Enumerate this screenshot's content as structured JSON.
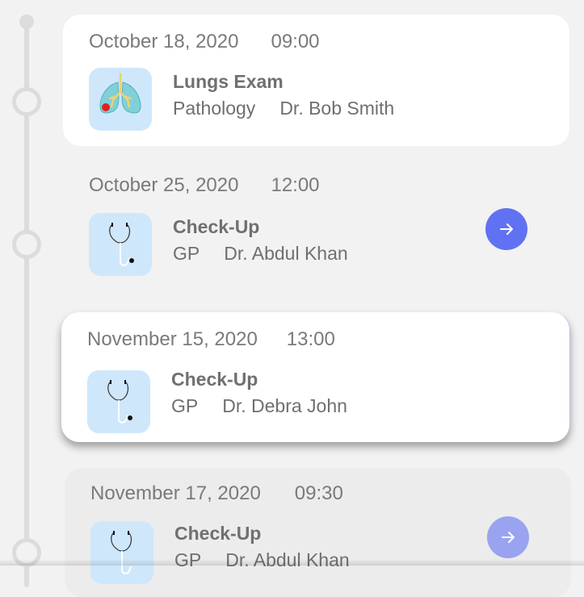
{
  "appointments": [
    {
      "date": "October 18, 2020",
      "time": "09:00",
      "title": "Lungs Exam",
      "department": "Pathology",
      "doctor": "Dr. Bob Smith",
      "icon": "lungs-icon"
    },
    {
      "date": "October 25, 2020",
      "time": "12:00",
      "title": "Check-Up",
      "department": "GP",
      "doctor": "Dr. Abdul Khan",
      "icon": "stethoscope-icon",
      "action_icon": "arrow-right-icon"
    },
    {
      "date": "November 15, 2020",
      "time": "13:00",
      "title": "Check-Up",
      "department": "GP",
      "doctor": "Dr. Debra John",
      "icon": "stethoscope-icon"
    },
    {
      "date": "November 17, 2020",
      "time": "09:30",
      "title": "Check-Up",
      "department": "GP",
      "doctor": "Dr. Abdul Khan",
      "icon": "stethoscope-icon",
      "action_icon": "arrow-right-icon"
    }
  ],
  "colors": {
    "accent": "#6072f2",
    "accent_faded": "#9aa3f0",
    "icon_bg": "#cfe7fb",
    "timeline": "#dcdcdc",
    "background": "#f2f2f2"
  }
}
